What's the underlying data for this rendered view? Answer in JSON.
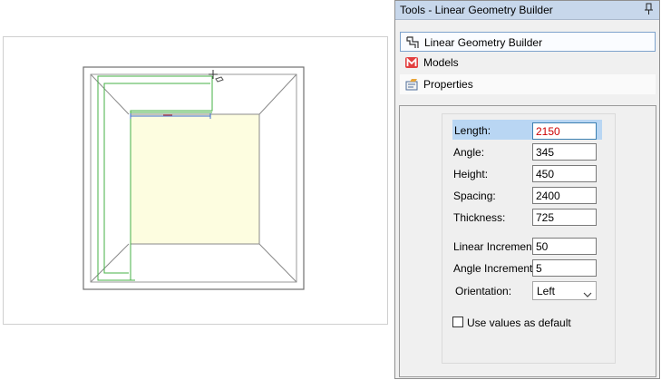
{
  "panel": {
    "title": "Tools - Linear Geometry Builder",
    "pin_icon": "pin-icon",
    "nav": [
      {
        "label": "Linear Geometry Builder",
        "icon": "linear-geometry-icon"
      },
      {
        "label": "Models",
        "icon": "models-icon"
      },
      {
        "label": "Properties",
        "icon": "properties-icon"
      }
    ]
  },
  "form": {
    "length_label": "Length:",
    "length_value": "2150",
    "angle_label": "Angle:",
    "angle_value": "345",
    "height_label": "Height:",
    "height_value": "450",
    "spacing_label": "Spacing:",
    "spacing_value": "2400",
    "thickness_label": "Thickness:",
    "thickness_value": "725",
    "linear_increment_label": "Linear Increment:",
    "linear_increment_value": "50",
    "angle_increment_label": "Angle Increment:",
    "angle_increment_value": "5",
    "orientation_label": "Orientation:",
    "orientation_value": "Left",
    "default_checkbox_label": "Use values as default",
    "default_checkbox_checked": false
  },
  "colors": {
    "accent_highlight": "#b9d6f3",
    "active_value": "#cc0000",
    "room_floor": "#fdfde0",
    "wall_green": "#45b045"
  }
}
